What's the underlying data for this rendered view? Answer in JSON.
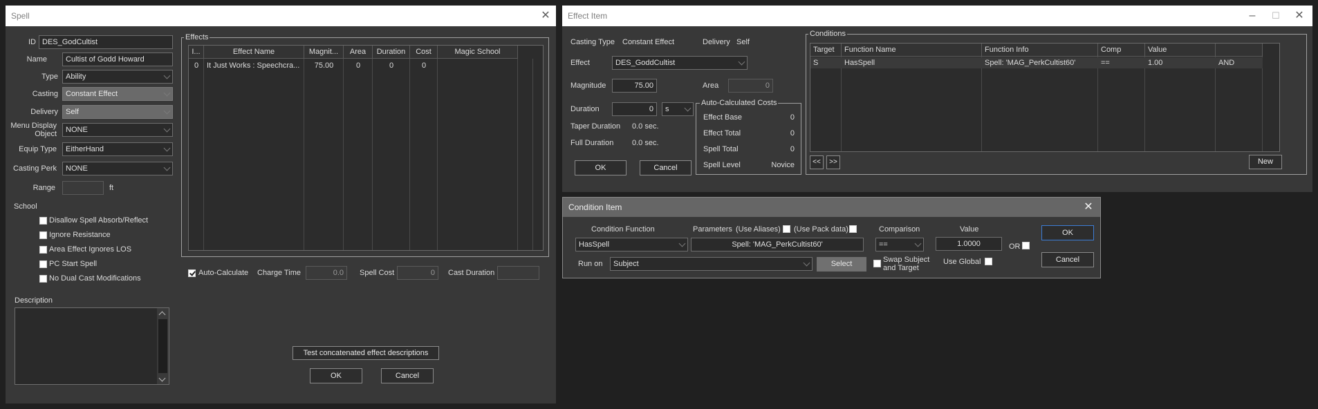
{
  "spell": {
    "title": "Spell",
    "id_label": "ID",
    "id_value": "DES_GodCultist",
    "name_label": "Name",
    "name_value": "Cultist of Godd Howard",
    "type_label": "Type",
    "type_value": "Ability",
    "casting_label": "Casting",
    "casting_value": "Constant Effect",
    "delivery_label": "Delivery",
    "delivery_value": "Self",
    "menu_display_label_1": "Menu Display",
    "menu_display_label_2": "Object",
    "menu_display_value": "NONE",
    "equip_type_label": "Equip Type",
    "equip_type_value": "EitherHand",
    "casting_perk_label": "Casting Perk",
    "casting_perk_value": "NONE",
    "range_label": "Range",
    "range_value": "",
    "range_unit": "ft",
    "school_label": "School",
    "flags": [
      {
        "label": "Disallow Spell Absorb/Reflect",
        "checked": false
      },
      {
        "label": "Ignore Resistance",
        "checked": false
      },
      {
        "label": "Area Effect Ignores LOS",
        "checked": false
      },
      {
        "label": "PC Start Spell",
        "checked": false
      },
      {
        "label": "No Dual Cast Modifications",
        "checked": false
      }
    ],
    "description_label": "Description",
    "description_value": "",
    "effects_group": "Effects",
    "effects_columns": [
      "I...",
      "Effect Name",
      "Magnit...",
      "Area",
      "Duration",
      "Cost",
      "Magic School"
    ],
    "effects_rows": [
      {
        "index": "0",
        "name": "It Just Works : Speechcra...",
        "magnitude": "75.00",
        "area": "0",
        "duration": "0",
        "cost": "0",
        "school": ""
      }
    ],
    "auto_calculate_label": "Auto-Calculate",
    "auto_calculate_checked": true,
    "charge_time_label": "Charge Time",
    "charge_time_value": "0.0",
    "spell_cost_label": "Spell Cost",
    "spell_cost_value": "0",
    "cast_duration_label": "Cast Duration",
    "cast_duration_value": "",
    "test_button": "Test concatenated effect descriptions",
    "ok_button": "OK",
    "cancel_button": "Cancel"
  },
  "effect_item": {
    "title": "Effect Item",
    "casting_type_label": "Casting Type",
    "casting_type_value": "Constant Effect",
    "delivery_label": "Delivery",
    "delivery_value": "Self",
    "effect_label": "Effect",
    "effect_value": "DES_GoddCultist",
    "magnitude_label": "Magnitude",
    "magnitude_value": "75.00",
    "area_label": "Area",
    "area_value": "0",
    "duration_label": "Duration",
    "duration_value": "0",
    "duration_unit": "s",
    "taper_duration_label": "Taper Duration",
    "taper_duration_value": "0.0 sec.",
    "full_duration_label": "Full Duration",
    "full_duration_value": "0.0 sec.",
    "costs_group": "Auto-Calculated Costs",
    "costs": [
      {
        "label": "Effect Base",
        "value": "0"
      },
      {
        "label": "Effect Total",
        "value": "0"
      },
      {
        "label": "Spell Total",
        "value": "0"
      },
      {
        "label": "Spell Level",
        "value": "Novice"
      }
    ],
    "ok_button": "OK",
    "cancel_button": "Cancel",
    "conditions_group": "Conditions",
    "conditions_columns": [
      "Target",
      "Function Name",
      "Function Info",
      "Comp",
      "Value",
      ""
    ],
    "conditions_rows": [
      {
        "target": "S",
        "function": "HasSpell",
        "info": "Spell: 'MAG_PerkCultist60'",
        "comp": "==",
        "value": "1.00",
        "op": "AND"
      }
    ],
    "prev_button": "<<",
    "next_button": ">>",
    "new_button": "New"
  },
  "condition_item": {
    "title": "Condition Item",
    "function_label": "Condition Function",
    "function_value": "HasSpell",
    "parameters_label": "Parameters",
    "use_aliases_label": "(Use Aliases)",
    "use_pack_data_label": "(Use Pack data)",
    "parameters_value": "Spell: 'MAG_PerkCultist60'",
    "comparison_label": "Comparison",
    "comparison_value": "==",
    "value_label": "Value",
    "value_value": "1.0000",
    "or_label": "OR",
    "run_on_label": "Run on",
    "run_on_value": "Subject",
    "select_button": "Select",
    "swap_label_1": "Swap Subject",
    "swap_label_2": "and Target",
    "use_global_label": "Use Global",
    "ok_button": "OK",
    "cancel_button": "Cancel"
  }
}
